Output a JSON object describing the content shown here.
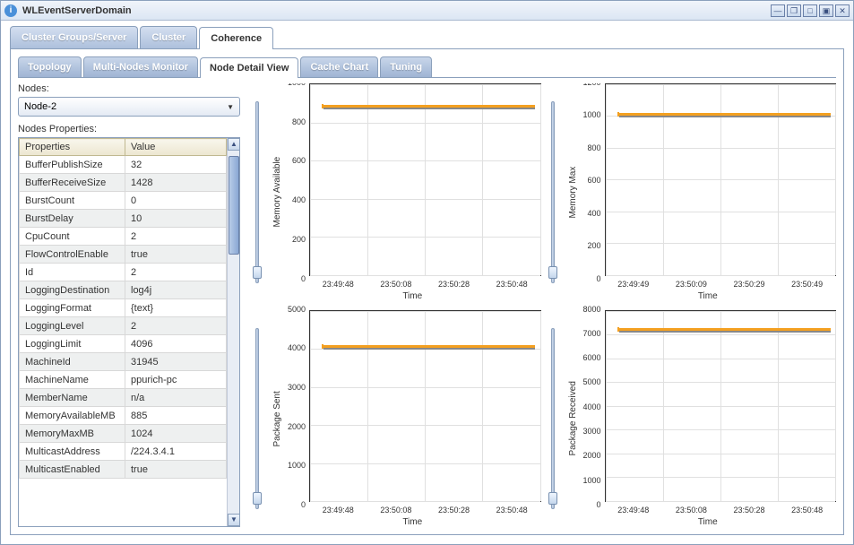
{
  "window": {
    "title": "WLEventServerDomain"
  },
  "outerTabs": [
    "Cluster Groups/Server",
    "Cluster",
    "Coherence"
  ],
  "outerActive": 2,
  "innerTabs": [
    "Topology",
    "Multi-Nodes Monitor",
    "Node Detail View",
    "Cache Chart",
    "Tuning"
  ],
  "innerActive": 2,
  "left": {
    "nodesLabel": "Nodes:",
    "selectedNode": "Node-2",
    "propsLabel": "Nodes Properties:",
    "headers": [
      "Properties",
      "Value"
    ],
    "rows": [
      [
        "BufferPublishSize",
        "32"
      ],
      [
        "BufferReceiveSize",
        "1428"
      ],
      [
        "BurstCount",
        "0"
      ],
      [
        "BurstDelay",
        "10"
      ],
      [
        "CpuCount",
        "2"
      ],
      [
        "FlowControlEnable",
        "true"
      ],
      [
        "Id",
        "2"
      ],
      [
        "LoggingDestination",
        "log4j"
      ],
      [
        "LoggingFormat",
        "{text}"
      ],
      [
        "LoggingLevel",
        "2"
      ],
      [
        "LoggingLimit",
        "4096"
      ],
      [
        "MachineId",
        "31945"
      ],
      [
        "MachineName",
        "ppurich-pc"
      ],
      [
        "MemberName",
        "n/a"
      ],
      [
        "MemoryAvailableMB",
        "885"
      ],
      [
        "MemoryMaxMB",
        "1024"
      ],
      [
        "MulticastAddress",
        "/224.3.4.1"
      ],
      [
        "MulticastEnabled",
        "true"
      ]
    ]
  },
  "chart_data": [
    {
      "type": "line",
      "ylabel": "Memory Available",
      "xlabel": "Time",
      "ylim": [
        0,
        1000
      ],
      "yticks": [
        0,
        200,
        400,
        600,
        800,
        1000
      ],
      "xticks": [
        "23:49:48",
        "23:50:08",
        "23:50:28",
        "23:50:48"
      ],
      "value_approx": 885,
      "line_pos_pct": 11
    },
    {
      "type": "line",
      "ylabel": "Memory Max",
      "xlabel": "Time",
      "ylim": [
        0,
        1200
      ],
      "yticks": [
        0,
        200,
        400,
        600,
        800,
        1000,
        1200
      ],
      "xticks": [
        "23:49:49",
        "23:50:09",
        "23:50:29",
        "23:50:49"
      ],
      "value_approx": 1024,
      "line_pos_pct": 15
    },
    {
      "type": "line",
      "ylabel": "Package Sent",
      "xlabel": "Time",
      "ylim": [
        0,
        5000
      ],
      "yticks": [
        0,
        1000,
        2000,
        3000,
        4000,
        5000
      ],
      "xticks": [
        "23:49:48",
        "23:50:08",
        "23:50:28",
        "23:50:48"
      ],
      "value_approx": 4100,
      "line_pos_pct": 18
    },
    {
      "type": "line",
      "ylabel": "Package Received",
      "xlabel": "Time",
      "ylim": [
        0,
        8000
      ],
      "yticks": [
        0,
        1000,
        2000,
        3000,
        4000,
        5000,
        6000,
        7000,
        8000
      ],
      "xticks": [
        "23:49:48",
        "23:50:08",
        "23:50:28",
        "23:50:48"
      ],
      "value_approx": 7300,
      "line_pos_pct": 9
    }
  ]
}
